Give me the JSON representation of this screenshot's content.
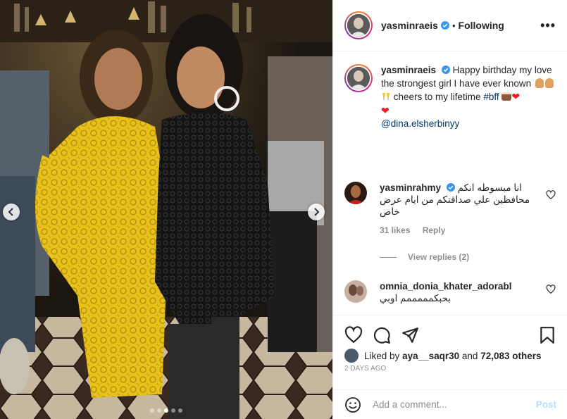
{
  "post": {
    "username": "yasminraeis",
    "follow_status": "Following",
    "separator": "•",
    "more_label": "•••",
    "carousel": {
      "total": 5,
      "active_index": 2
    }
  },
  "caption": {
    "username": "yasminraeis",
    "line1": "Happy birthday my love the strongest girl I have ever known",
    "line2": "cheers to my lifetime",
    "hashtag": "#bff",
    "mention": "@dina.elsherbinyy"
  },
  "comments": [
    {
      "username": "yasminrahmy",
      "text": "انا مبسوطه انكم محافظين علي صداقتكم من ايام عرض خاص",
      "likes": "31 likes",
      "reply_label": "Reply",
      "view_replies": "View replies (2)"
    },
    {
      "username": "omnia_donia_khater_adorabl",
      "text": "بحبكمممممم اوبي"
    }
  ],
  "likes": {
    "prefix": "Liked by",
    "user": "aya__saqr30",
    "joiner": "and",
    "others": "72,083 others"
  },
  "date_partial": "2 DAYS AGO",
  "add_comment": {
    "placeholder": "Add a comment...",
    "post_label": "Post"
  },
  "colors": {
    "accent": "#0095f6",
    "post_disabled": "#b2dffc",
    "muted": "#8e8e8e",
    "link": "#00376b",
    "verified": "#3897f0"
  }
}
